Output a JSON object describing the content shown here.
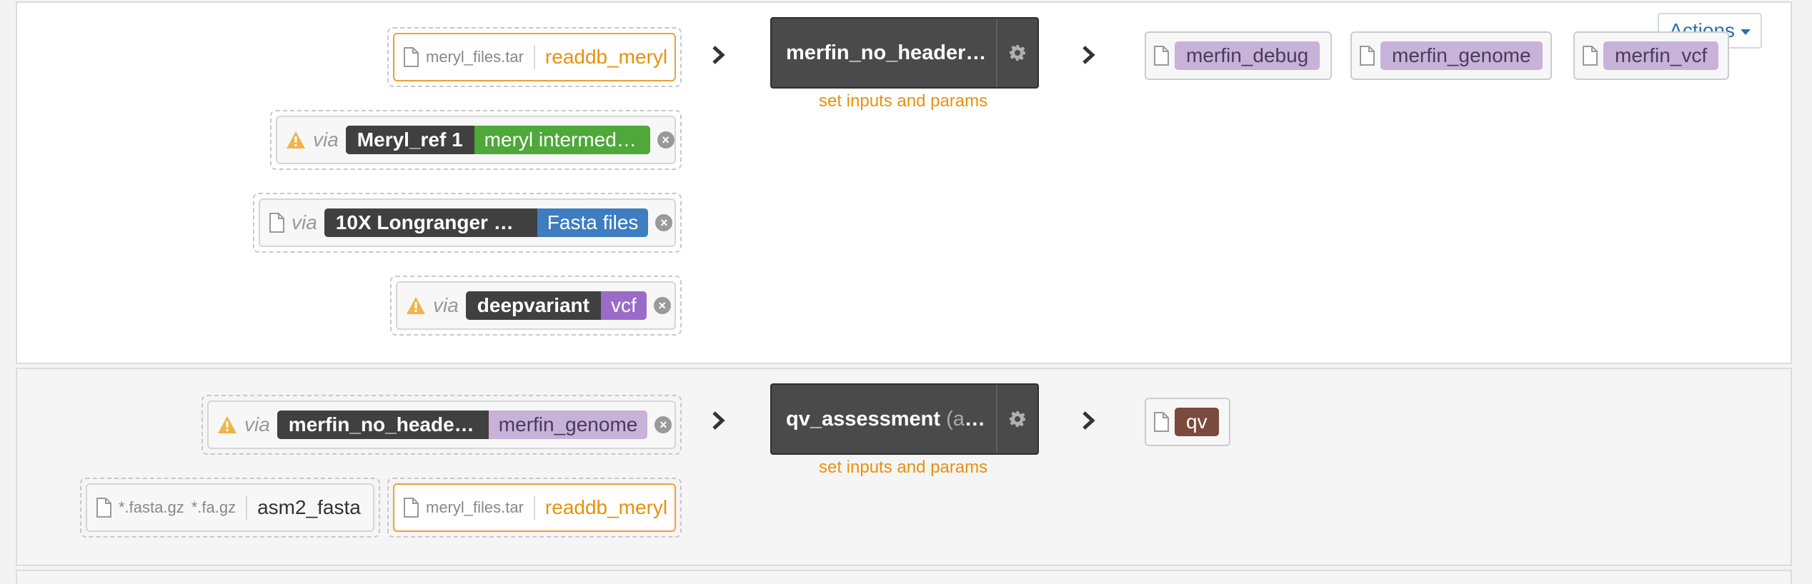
{
  "actions_label": "Actions",
  "colors": {
    "orange": "#e8910c",
    "green": "#4ea83a",
    "blue": "#3d7dc0",
    "purple": "#9b6bc9",
    "lavender": "#c7b2d9",
    "brown": "#7a4a3c",
    "dark": "#404040"
  },
  "step1": {
    "inputs": [
      {
        "kind": "file",
        "type": "meryl_files.tar",
        "name": "readdb_meryl"
      },
      {
        "kind": "via",
        "warning": true,
        "via": "via",
        "step": "Meryl_ref 1",
        "output": "meryl intermed…",
        "color": "#4ea83a"
      },
      {
        "kind": "via",
        "warning": false,
        "via": "via",
        "step": "10X Longranger …",
        "output": "Fasta files",
        "color": "#3d7dc0"
      },
      {
        "kind": "via",
        "warning": true,
        "via": "via",
        "step": "deepvariant",
        "output": "vcf",
        "color": "#9b6bc9"
      }
    ],
    "tool": {
      "name": "merfin_no_header_…",
      "icon": "gear-icon"
    },
    "set_link": "set inputs and params",
    "outputs": [
      "merfin_debug",
      "merfin_genome",
      "merfin_vcf"
    ]
  },
  "step2": {
    "inputs": [
      {
        "kind": "via",
        "warning": true,
        "via": "via",
        "step": "merfin_no_heade…",
        "output": "merfin_genome",
        "color": "#c7b2d9"
      },
      {
        "kind": "file",
        "types": [
          "*.fasta.gz",
          "*.fa.gz"
        ],
        "name": "asm2_fasta"
      },
      {
        "kind": "file",
        "type": "meryl_files.tar",
        "name": "readdb_meryl"
      }
    ],
    "tool": {
      "name": "qv_assessment",
      "suffix": "(ap…",
      "icon": "gear-icon"
    },
    "set_link": "set inputs and params",
    "outputs": [
      "qv"
    ]
  }
}
